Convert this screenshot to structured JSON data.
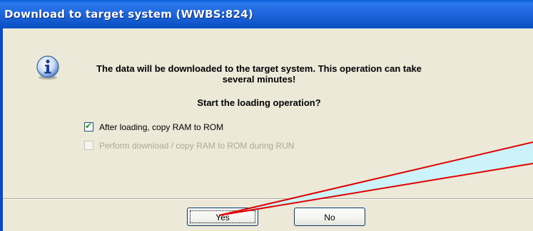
{
  "dialog": {
    "title": "Download to target system (WWBS:824)",
    "icon": "info-icon",
    "message": "The data will be downloaded to the target system. This operation can take several minutes!",
    "question": "Start the loading operation?",
    "options": [
      {
        "label": "After loading, copy RAM to ROM",
        "checked": true,
        "enabled": true
      },
      {
        "label": "Perform download / copy RAM to ROM during RUN",
        "checked": false,
        "enabled": false
      }
    ],
    "buttons": {
      "yes_label": "Yes",
      "no_label": "No"
    }
  },
  "colors": {
    "titlebar": "#0a5fd8",
    "dialog_bg": "#ece9d8",
    "callout_fill": "#c6f4ff",
    "callout_line": "#e00000"
  }
}
